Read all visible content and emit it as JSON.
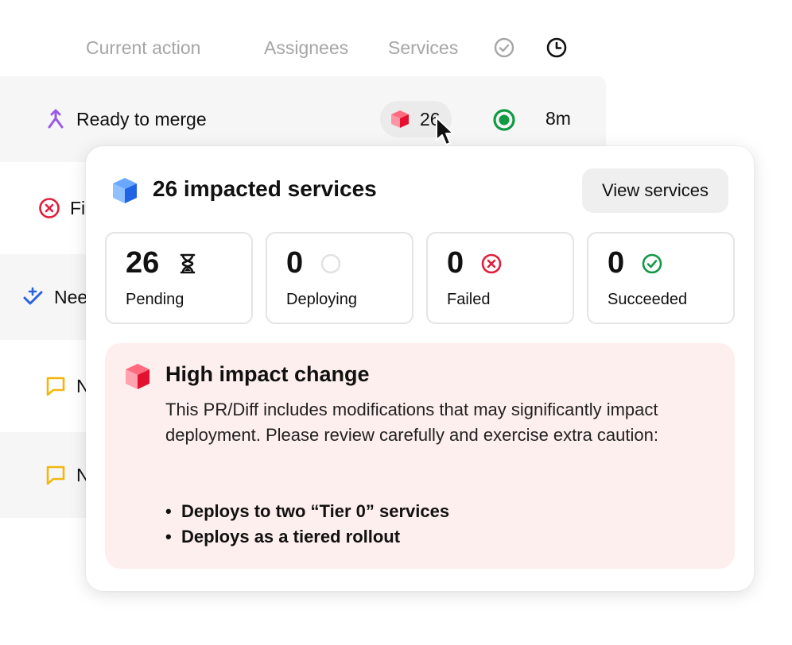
{
  "header": {
    "current_action": "Current action",
    "assignees": "Assignees",
    "services": "Services"
  },
  "rows": [
    {
      "label": "Ready to merge",
      "icon": "merge-icon",
      "services_count": "26",
      "time": "8m"
    },
    {
      "label": "Fi",
      "icon": "failed-icon"
    },
    {
      "label": "Nee",
      "icon": "needs-review-icon"
    },
    {
      "label": "N",
      "icon": "comment-icon"
    },
    {
      "label": "N",
      "icon": "comment-icon"
    }
  ],
  "popover": {
    "title": "26 impacted services",
    "view_button": "View services",
    "stats": [
      {
        "value": "26",
        "label": "Pending",
        "icon": "hourglass-icon"
      },
      {
        "value": "0",
        "label": "Deploying",
        "icon": "empty-circle-icon"
      },
      {
        "value": "0",
        "label": "Failed",
        "icon": "failed-icon"
      },
      {
        "value": "0",
        "label": "Succeeded",
        "icon": "check-circle-icon"
      }
    ],
    "alert": {
      "title": "High impact change",
      "body": "This PR/Diff includes modifications that may significantly impact deployment. Please review carefully and exercise extra caution:",
      "bullets": [
        "Deploys to two “Tier 0” services",
        "Deploys as a tiered rollout"
      ]
    }
  },
  "colors": {
    "merge_purple": "#9b59e8",
    "failed_red": "#e11d3c",
    "success_green": "#119944",
    "review_blue": "#2a62e0",
    "comment_yellow": "#f2b70f",
    "alert_bg": "#fdefed"
  }
}
